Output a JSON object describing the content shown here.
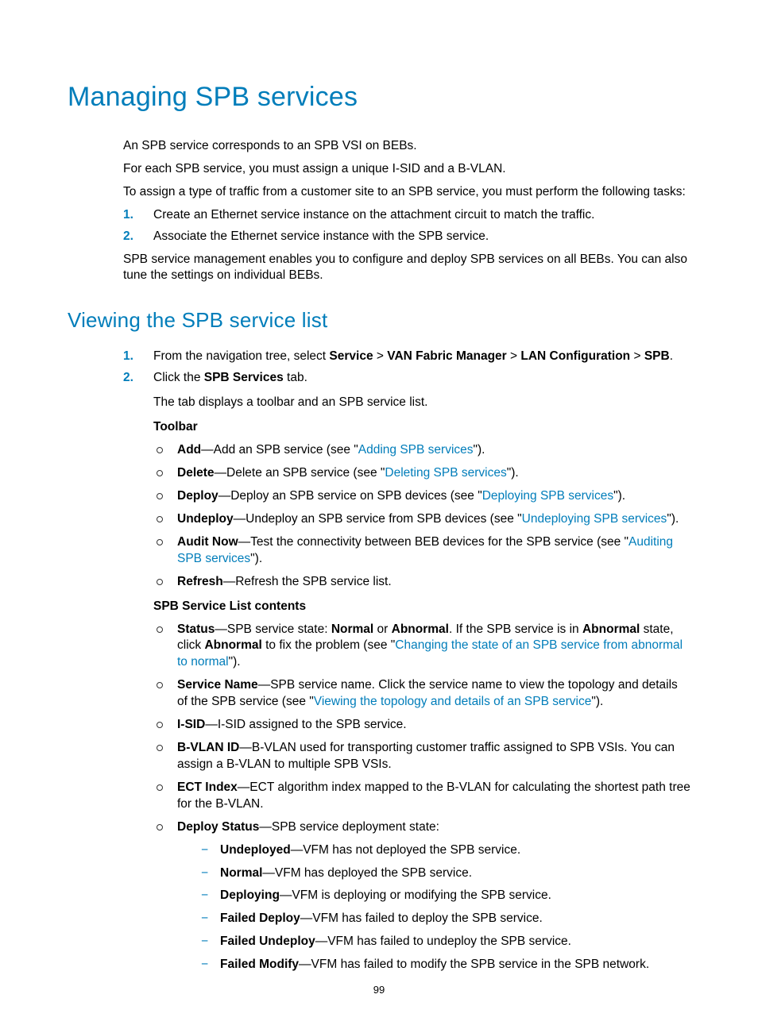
{
  "h1": "Managing SPB services",
  "intro": {
    "p1": "An SPB service corresponds to an SPB VSI on BEBs.",
    "p2": "For each SPB service, you must assign a unique I-SID and a B-VLAN.",
    "p3": "To assign a type of traffic from a customer site to an SPB service, you must perform the following tasks:",
    "ol": [
      "Create an Ethernet service instance on the attachment circuit to match the traffic.",
      "Associate the Ethernet service instance with the SPB service."
    ],
    "p4": "SPB service management enables you to configure and deploy SPB services on all BEBs. You can also tune the settings on individual BEBs."
  },
  "h2": "Viewing the SPB service list",
  "nav": {
    "lead": "From the navigation tree, select ",
    "service": "Service",
    "sep": " > ",
    "vfm": "VAN Fabric Manager",
    "lan": "LAN Configuration",
    "spb": "SPB",
    "period": "."
  },
  "step2": {
    "lead": "Click the ",
    "bold": "SPB Services",
    "tail": " tab."
  },
  "tabnote": "The tab displays a toolbar and an SPB service list.",
  "toolbar": {
    "heading": "Toolbar",
    "items": [
      {
        "b": "Add",
        "t1": "—Add an SPB service (see \"",
        "link": "Adding SPB services",
        "t2": "\")."
      },
      {
        "b": "Delete",
        "t1": "—Delete an SPB service (see \"",
        "link": "Deleting SPB services",
        "t2": "\")."
      },
      {
        "b": "Deploy",
        "t1": "—Deploy an SPB service on SPB devices (see \"",
        "link": "Deploying SPB services",
        "t2": "\")."
      },
      {
        "b": "Undeploy",
        "t1": "—Undeploy an SPB service from SPB devices (see \"",
        "link": "Undeploying SPB services",
        "t2": "\")."
      },
      {
        "b": "Audit Now",
        "t1": "—Test the connectivity between BEB devices for the SPB service (see \"",
        "link": "Auditing SPB services",
        "t2": "\")."
      },
      {
        "b": "Refresh",
        "t1": "—Refresh the SPB service list.",
        "link": "",
        "t2": ""
      }
    ]
  },
  "listcontents": {
    "heading": "SPB Service List contents",
    "status": {
      "b": "Status",
      "t1": "—SPB service state: ",
      "b2": "Normal",
      "t2": " or ",
      "b3": "Abnormal",
      "t3": ". If the SPB service is in ",
      "b4": "Abnormal",
      "t4": " state, click ",
      "b5": "Abnormal",
      "t5": " to fix the problem (see \"",
      "link": "Changing the state of an SPB service from abnormal to normal",
      "t6": "\")."
    },
    "servicename": {
      "b": "Service Name",
      "t1": "—SPB service name. Click the service name to view the topology and details of the SPB service (see \"",
      "link": "Viewing the topology and details of an SPB service",
      "t2": "\")."
    },
    "isid": {
      "b": "I-SID",
      "t": "—I-SID assigned to the SPB service."
    },
    "bvlan": {
      "b": "B-VLAN ID",
      "t": "—B-VLAN used for transporting customer traffic assigned to SPB VSIs. You can assign a B-VLAN to multiple SPB VSIs."
    },
    "ect": {
      "b": "ECT Index",
      "t": "—ECT algorithm index mapped to the B-VLAN for calculating the shortest path tree for the B-VLAN."
    },
    "deploystatus": {
      "b": "Deploy Status",
      "t": "—SPB service deployment state:"
    },
    "states": [
      {
        "b": "Undeployed",
        "t": "—VFM has not deployed the SPB service."
      },
      {
        "b": "Normal",
        "t": "—VFM has deployed the SPB service."
      },
      {
        "b": "Deploying",
        "t": "—VFM is deploying or modifying the SPB service."
      },
      {
        "b": "Failed Deploy",
        "t": "—VFM has failed to deploy the SPB service."
      },
      {
        "b": "Failed Undeploy",
        "t": "—VFM has failed to undeploy the SPB service."
      },
      {
        "b": "Failed Modify",
        "t": "—VFM has failed to modify the SPB service in the SPB network."
      }
    ]
  },
  "pagenum": "99"
}
